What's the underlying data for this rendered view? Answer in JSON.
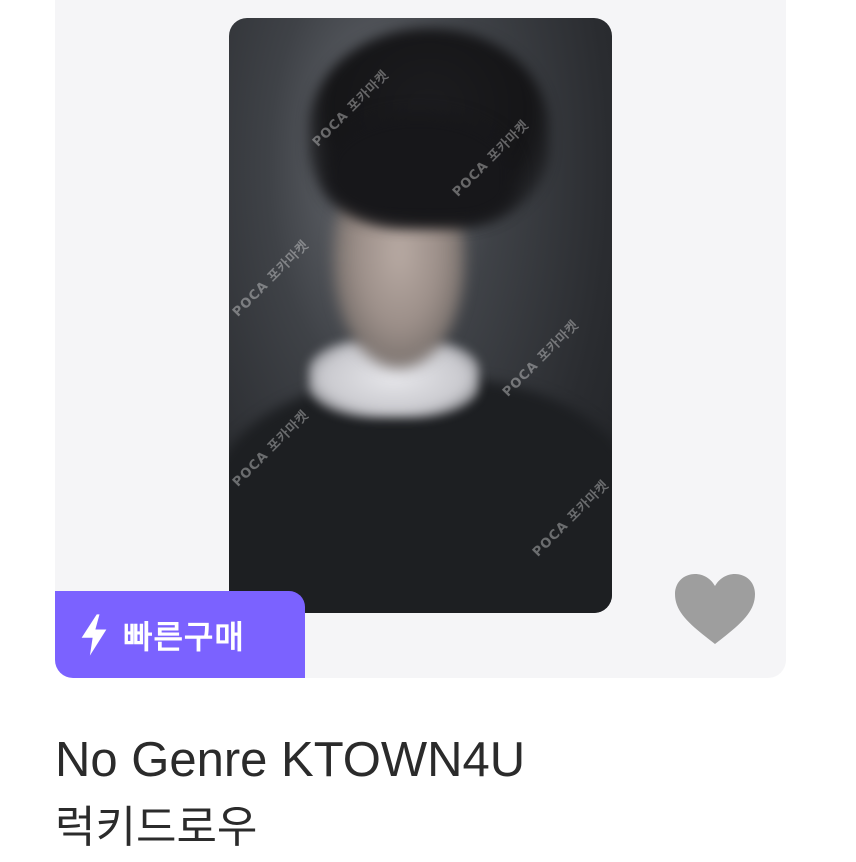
{
  "product": {
    "badge_label": "빠른구매",
    "badge_color": "#7b62ff",
    "heart_color": "#9e9e9e",
    "title_line1": "No Genre KTOWN4U",
    "title_line2": "럭키드로우",
    "photo_icon": "photocard-image",
    "watermark_text": "POCA 포카마켓"
  }
}
